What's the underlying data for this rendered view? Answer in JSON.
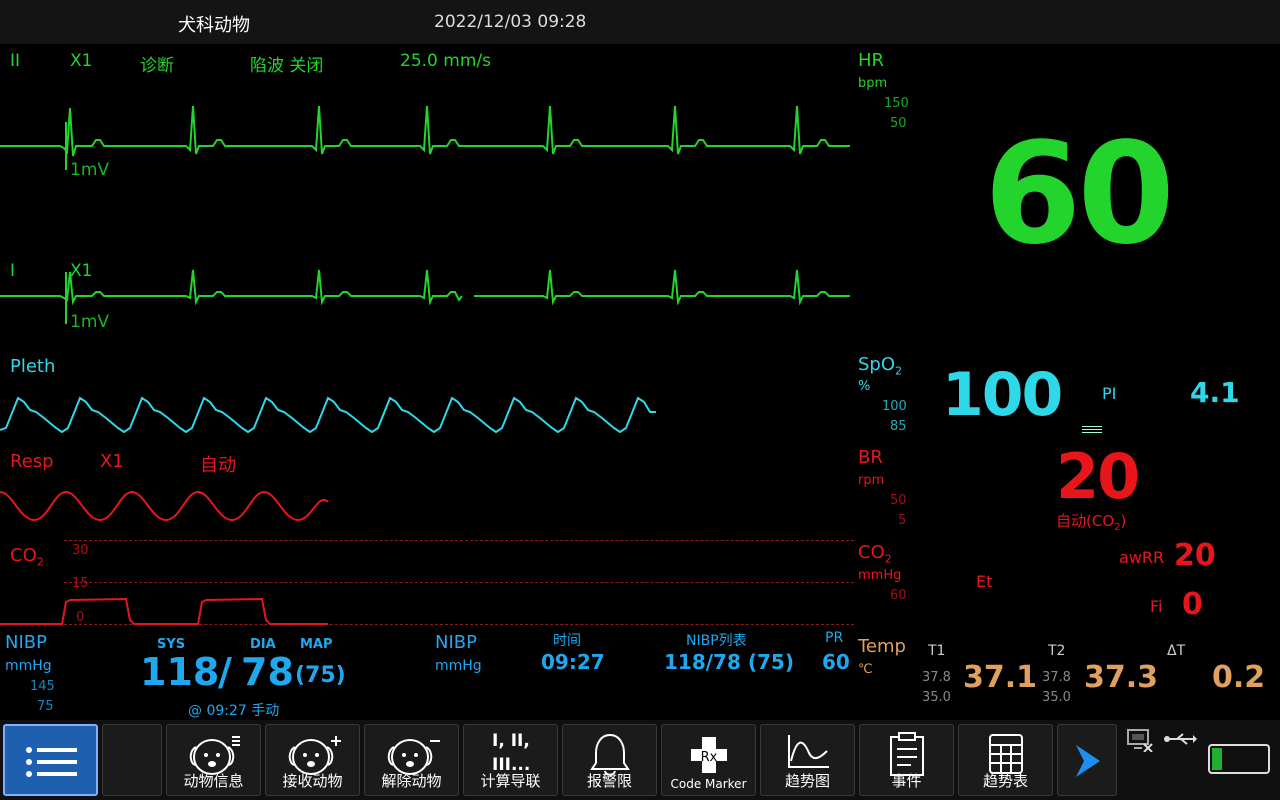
{
  "topbar": {
    "department": "犬科动物",
    "datetime": "2022/12/03 09:28"
  },
  "ecg": {
    "lead1": "II",
    "gain1": "X1",
    "mode": "诊断",
    "notch": "陷波 关闭",
    "speed": "25.0 mm/s",
    "scale1": "1mV",
    "lead2": "I",
    "gain2": "X1",
    "scale2": "1mV"
  },
  "hr": {
    "label": "HR",
    "unit": "bpm",
    "limit_high": "150",
    "limit_low": "50",
    "value": "60"
  },
  "pleth": {
    "label": "Pleth"
  },
  "spo2": {
    "label": "SpO",
    "sub": "2",
    "unit": "%",
    "limit_high": "100",
    "limit_low": "85",
    "value": "100",
    "pi_label": "PI",
    "pi_value": "4.1"
  },
  "resp": {
    "label": "Resp",
    "gain": "X1",
    "mode": "自动"
  },
  "br": {
    "label": "BR",
    "unit": "rpm",
    "limit_high": "50",
    "limit_low": "5",
    "value": "20",
    "source": "自动(CO",
    "source_sub": "2",
    "source_end": ")"
  },
  "co2_wave": {
    "label": "CO",
    "sub": "2",
    "scale_top": "30",
    "scale_mid": "15",
    "scale_bottom": "0"
  },
  "co2": {
    "label": "CO",
    "sub": "2",
    "unit": "mmHg",
    "limit": "60",
    "awrr_label": "awRR",
    "awrr_value": "20",
    "et_label": "Et",
    "fi_label": "Fi",
    "fi_value": "0"
  },
  "nibp": {
    "label": "NIBP",
    "unit": "mmHg",
    "limit_high": "145",
    "limit_low": "75",
    "sys_label": "SYS",
    "dia_label": "DIA",
    "map_label": "MAP",
    "sys": "118",
    "sep": "/",
    "dia": "78",
    "map": "(75)",
    "time_note": "@ 09:27  手动"
  },
  "nibp_list": {
    "label": "NIBP",
    "unit": "mmHg",
    "time_label": "时间",
    "time_value": "09:27",
    "list_label": "NIBP列表",
    "list_value": "118/78 (75)",
    "pr_label": "PR",
    "pr_value": "60"
  },
  "temp": {
    "label": "Temp",
    "unit": "℃",
    "t1_label": "T1",
    "t1_high": "37.8",
    "t1_low": "35.0",
    "t1_value": "37.1",
    "t2_label": "T2",
    "t2_high": "37.8",
    "t2_low": "35.0",
    "t2_value": "37.3",
    "dt_label": "ΔT",
    "dt_value": "0.2"
  },
  "toolbar": {
    "patient_info": "动物信息",
    "admit": "接收动物",
    "discharge": "解除动物",
    "calc_text": "I, II,",
    "calc_text2": "III...",
    "calc": "计算导联",
    "alarm_limits": "报警限",
    "code_marker": "Code Marker",
    "trend_graph": "趋势图",
    "events": "事件",
    "trend_table": "趋势表"
  },
  "colors": {
    "ecg": "#22d42c",
    "spo2": "#2fd8e8",
    "resp": "#e8161a",
    "nibp": "#1fa8f0",
    "temp": "#e0a060"
  }
}
